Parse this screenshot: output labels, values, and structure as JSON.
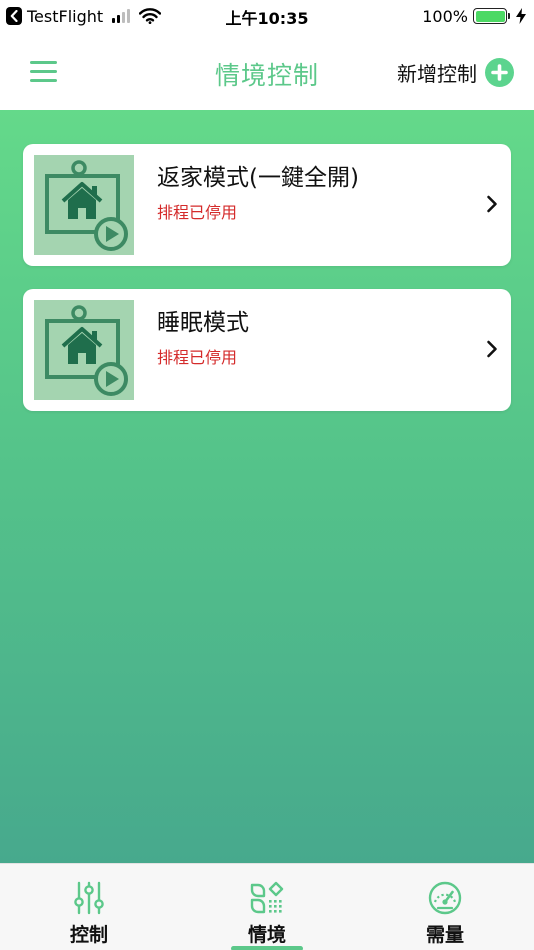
{
  "status_bar": {
    "back_app": "TestFlight",
    "time": "上午10:35",
    "battery_percent": "100%",
    "battery_level": 1.0,
    "signal_bars_active": 2,
    "signal_bars_total": 4
  },
  "nav": {
    "title": "情境控制",
    "add_label": "新增控制"
  },
  "scenes": [
    {
      "name": "返家模式(一鍵全開)",
      "status": "排程已停用"
    },
    {
      "name": "睡眠模式",
      "status": "排程已停用"
    }
  ],
  "tabs": [
    {
      "label": "控制",
      "icon": "sliders-icon",
      "selected": false
    },
    {
      "label": "情境",
      "icon": "scene-icon",
      "selected": true
    },
    {
      "label": "需量",
      "icon": "gauge-icon",
      "selected": false
    }
  ],
  "colors": {
    "accent": "#5cc88a",
    "status_disabled": "#d42b2b",
    "gradient_top": "#64d98a",
    "gradient_bottom": "#47a98d",
    "thumb_bg": "#a4d4b0",
    "thumb_icon": "#3d8a63"
  }
}
